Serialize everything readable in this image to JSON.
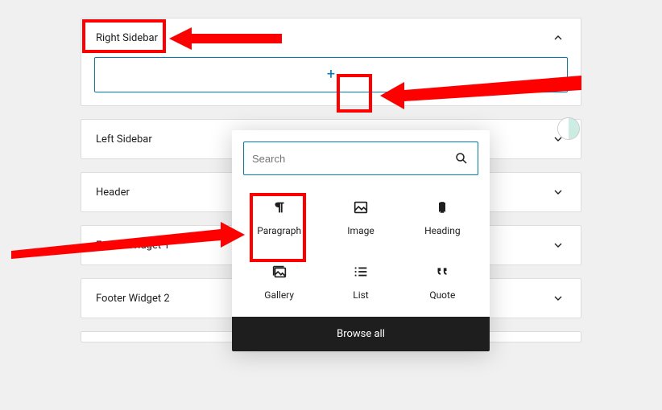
{
  "areas": {
    "right_sidebar": {
      "title": "Right Sidebar"
    },
    "left_sidebar": {
      "title": "Left Sidebar"
    },
    "header": {
      "title": "Header"
    },
    "footer_widget_1": {
      "title": "Footer Widget 1"
    },
    "footer_widget_2": {
      "title": "Footer Widget 2"
    }
  },
  "inserter": {
    "search_placeholder": "Search",
    "blocks": [
      {
        "key": "paragraph",
        "label": "Paragraph"
      },
      {
        "key": "image",
        "label": "Image"
      },
      {
        "key": "heading",
        "label": "Heading"
      },
      {
        "key": "gallery",
        "label": "Gallery"
      },
      {
        "key": "list",
        "label": "List"
      },
      {
        "key": "quote",
        "label": "Quote"
      }
    ],
    "browse_all": "Browse all"
  },
  "annotations": {
    "callout_color": "#ff0000"
  }
}
